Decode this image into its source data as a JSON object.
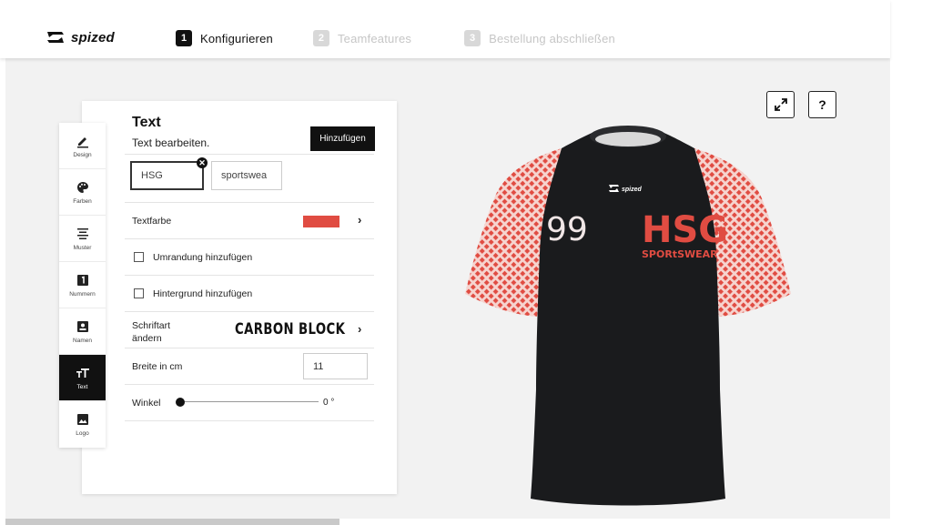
{
  "brand": {
    "name": "spized"
  },
  "steps": [
    {
      "num": "1",
      "label": "Konfigurieren",
      "state": "active"
    },
    {
      "num": "2",
      "label": "Teamfeatures",
      "state": "inactive"
    },
    {
      "num": "3",
      "label": "Bestellung abschließen",
      "state": "inactive"
    }
  ],
  "sidenav": [
    {
      "label": "Design",
      "icon": "pencil-icon"
    },
    {
      "label": "Farben",
      "icon": "palette-icon"
    },
    {
      "label": "Muster",
      "icon": "pattern-icon"
    },
    {
      "label": "Nummern",
      "icon": "number-icon"
    },
    {
      "label": "Namen",
      "icon": "name-badge-icon"
    },
    {
      "label": "Text",
      "icon": "text-icon",
      "active": true
    },
    {
      "label": "Logo",
      "icon": "image-icon"
    }
  ],
  "panel": {
    "title": "Text",
    "subtitle": "Text bearbeiten.",
    "add_button": "Hinzufügen",
    "chips": [
      {
        "value": "HSG",
        "selected": true
      },
      {
        "value": "sportswea",
        "selected": false
      }
    ],
    "text_color": {
      "label": "Textfarbe",
      "value": "#e04c42"
    },
    "outline_label": "Umrandung hinzufügen",
    "outline_checked": false,
    "background_label": "Hintergrund hinzufügen",
    "background_checked": false,
    "font": {
      "label_line1": "Schriftart",
      "label_line2": "ändern",
      "value": "CARBON BLOCK"
    },
    "width": {
      "label": "Breite in cm",
      "value": "11"
    },
    "angle": {
      "label": "Winkel",
      "value": "0 °",
      "level": 0
    }
  },
  "tools": {
    "fullscreen_icon": "expand-icon",
    "help_label": "?"
  },
  "jersey": {
    "number": "99",
    "main_text": "HSG",
    "sub_text": "SPORtSWEAR",
    "brand": "spized",
    "colors": {
      "body": "#1a1b1d",
      "accent": "#e04c42",
      "pattern_bg": "#f6d4cf"
    }
  }
}
